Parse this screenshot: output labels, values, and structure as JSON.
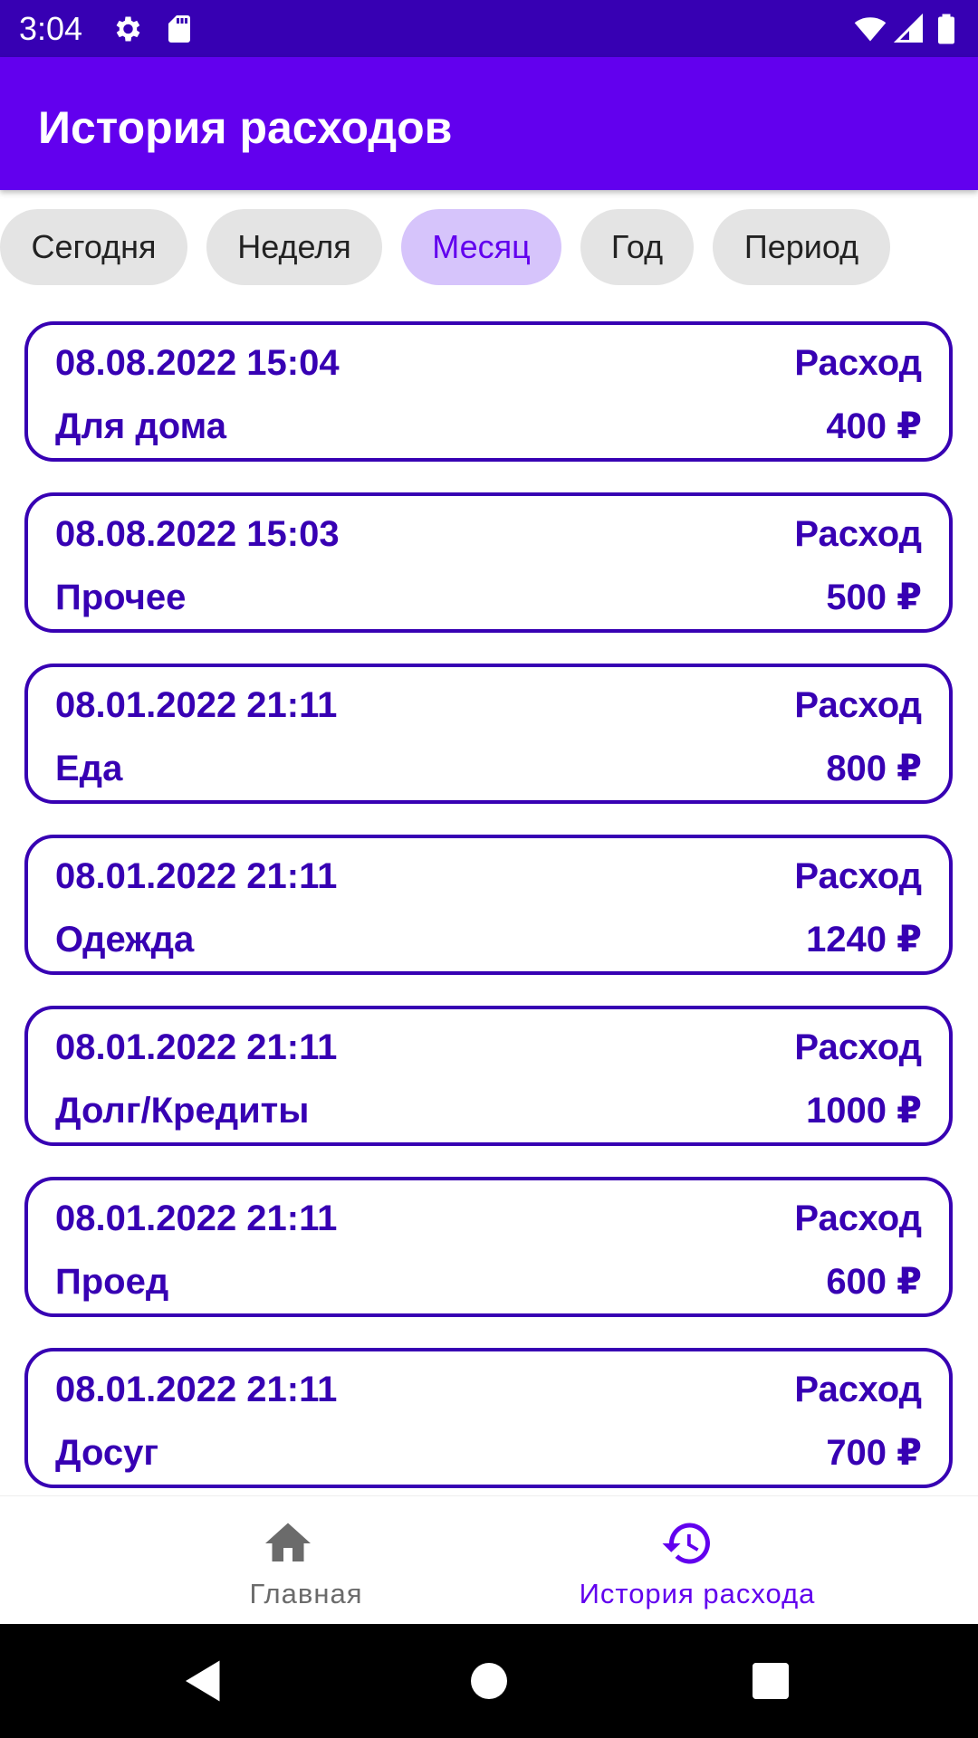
{
  "status_bar": {
    "time": "3:04",
    "icons": [
      "settings-icon",
      "sd-card-icon",
      "wifi-icon",
      "signal-icon",
      "battery-icon"
    ]
  },
  "app_bar": {
    "title": "История расходов"
  },
  "filters": {
    "chips": [
      {
        "label": "Сегодня",
        "selected": false
      },
      {
        "label": "Неделя",
        "selected": false
      },
      {
        "label": "Месяц",
        "selected": true
      },
      {
        "label": "Год",
        "selected": false
      },
      {
        "label": "Период",
        "selected": false
      }
    ]
  },
  "transactions": [
    {
      "datetime": "08.08.2022 15:04",
      "type": "Расход",
      "category": "Для дома",
      "amount": "400 ₽"
    },
    {
      "datetime": "08.08.2022 15:03",
      "type": "Расход",
      "category": "Прочее",
      "amount": "500 ₽"
    },
    {
      "datetime": "08.01.2022 21:11",
      "type": "Расход",
      "category": "Еда",
      "amount": "800 ₽"
    },
    {
      "datetime": "08.01.2022 21:11",
      "type": "Расход",
      "category": "Одежда",
      "amount": "1240 ₽"
    },
    {
      "datetime": "08.01.2022 21:11",
      "type": "Расход",
      "category": "Долг/Кредиты",
      "amount": "1000 ₽"
    },
    {
      "datetime": "08.01.2022 21:11",
      "type": "Расход",
      "category": "Проед",
      "amount": "600 ₽"
    },
    {
      "datetime": "08.01.2022 21:11",
      "type": "Расход",
      "category": "Досуг",
      "amount": "700 ₽"
    }
  ],
  "bottom_nav": {
    "items": [
      {
        "label": "Главная",
        "icon": "home-icon",
        "active": false
      },
      {
        "label": "История расхода",
        "icon": "history-icon",
        "active": true
      }
    ]
  },
  "system_nav": {
    "buttons": [
      "back-icon",
      "home-circle-icon",
      "recents-icon"
    ]
  },
  "colors": {
    "status_bar": "#3700b3",
    "app_bar": "#6200ee",
    "accent": "#6200ee",
    "card_text": "#3700b3",
    "chip_selected_bg": "#d6c4fb",
    "chip_bg": "#e4e4e4"
  }
}
